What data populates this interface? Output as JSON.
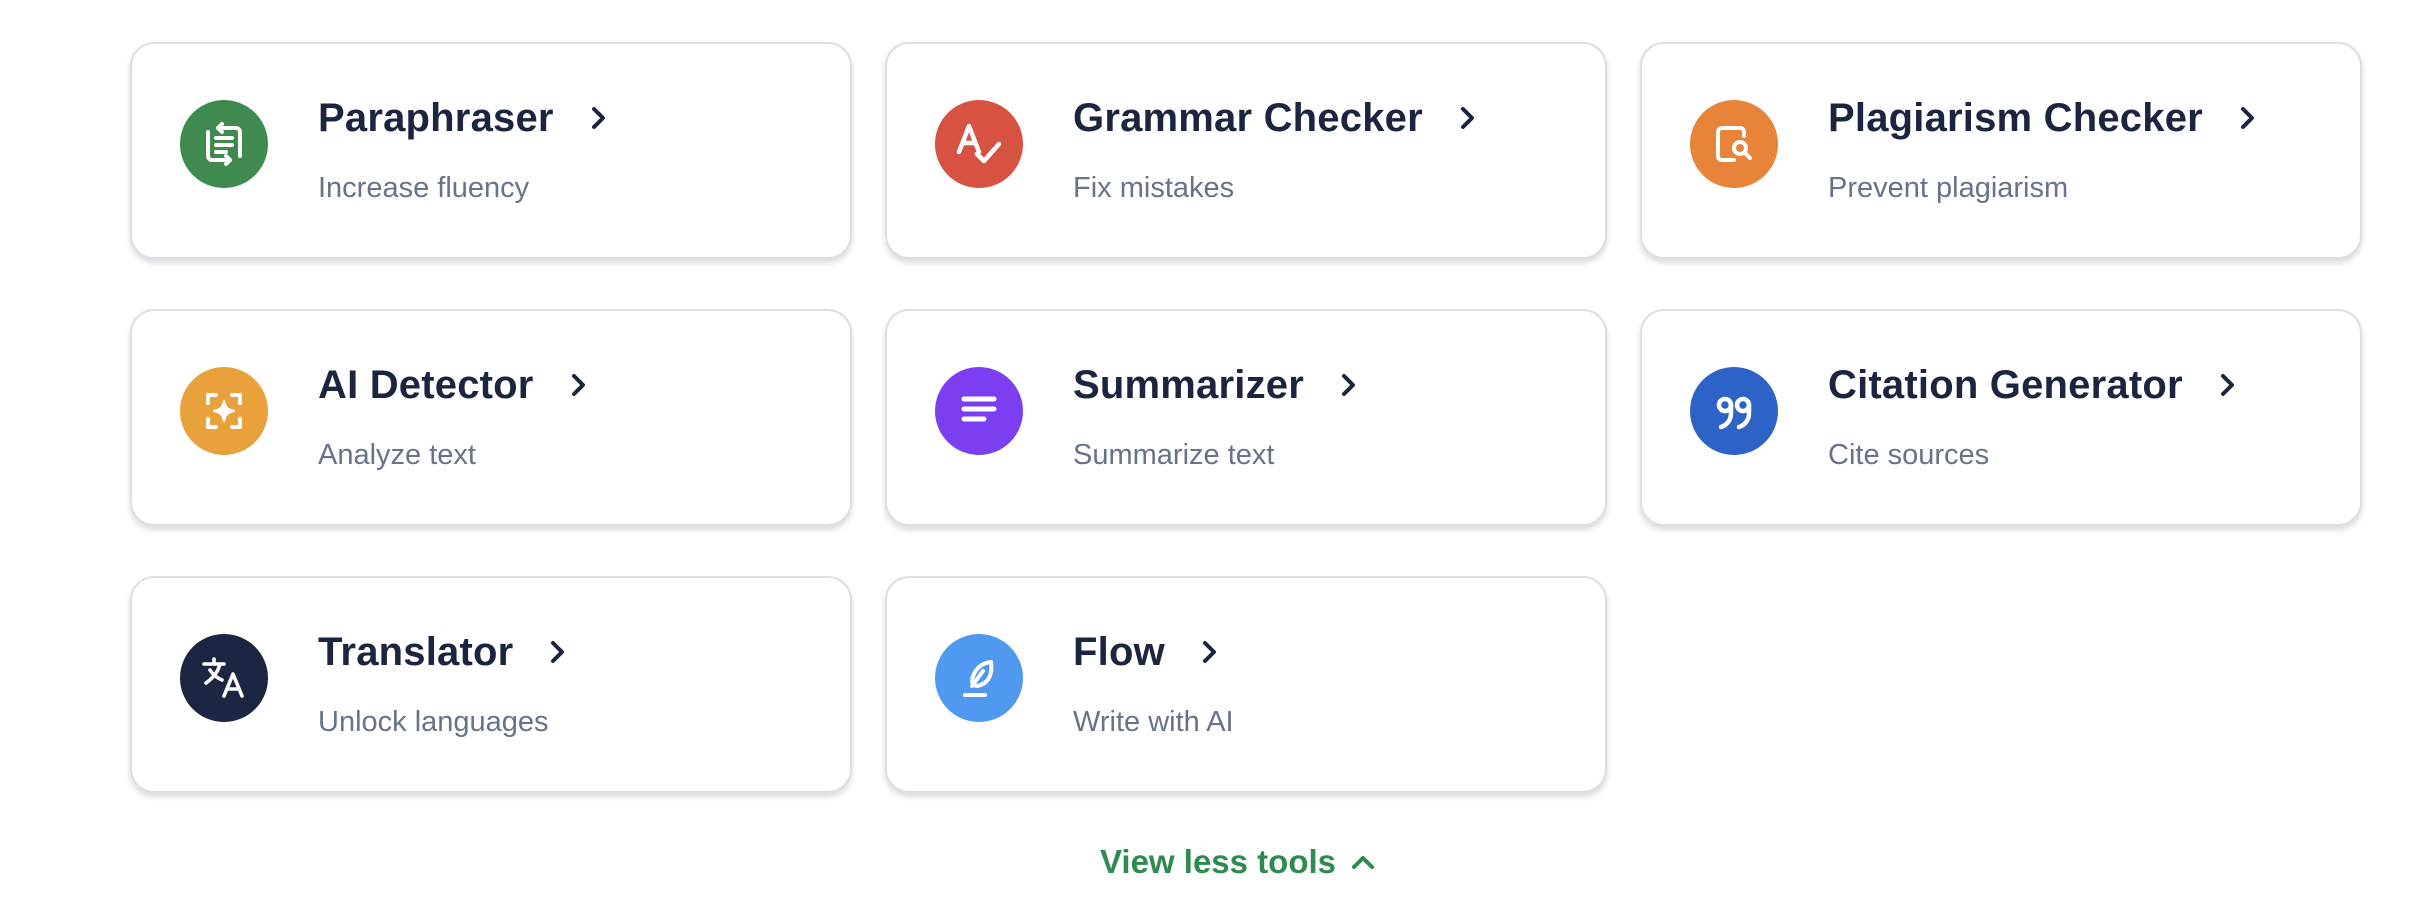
{
  "tools": [
    {
      "title": "Paraphraser",
      "subtitle": "Increase fluency",
      "icon": "paraphraser-icon",
      "color": "#3f8a4f"
    },
    {
      "title": "Grammar Checker",
      "subtitle": "Fix mistakes",
      "icon": "grammar-check-icon",
      "color": "#d85241"
    },
    {
      "title": "Plagiarism Checker",
      "subtitle": "Prevent plagiarism",
      "icon": "plagiarism-search-icon",
      "color": "#e8843a"
    },
    {
      "title": "AI Detector",
      "subtitle": "Analyze text",
      "icon": "ai-sparkle-frame-icon",
      "color": "#e9a23b"
    },
    {
      "title": "Summarizer",
      "subtitle": "Summarize text",
      "icon": "summary-lines-icon",
      "color": "#7b3ef0"
    },
    {
      "title": "Citation Generator",
      "subtitle": "Cite sources",
      "icon": "quote-marks-icon",
      "color": "#2d62c7"
    },
    {
      "title": "Translator",
      "subtitle": "Unlock languages",
      "icon": "translate-icon",
      "color": "#1c2643"
    },
    {
      "title": "Flow",
      "subtitle": "Write with AI",
      "icon": "quill-pen-icon",
      "color": "#4f99f0"
    }
  ],
  "view_less": {
    "label": "View less tools",
    "icon": "chevron-up-icon"
  },
  "colors": {
    "title_text": "#1b2540",
    "subtitle_text": "#677389",
    "card_border": "#dcdfe3",
    "link_green": "#2e8a4e"
  }
}
